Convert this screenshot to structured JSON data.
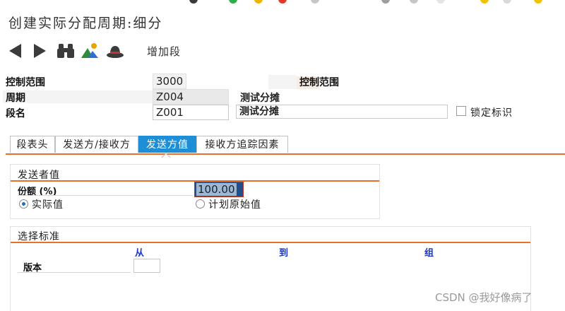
{
  "window": {
    "title": "创建实际分配周期:细分"
  },
  "toolbar": {
    "back_icon": "triangle-left-icon",
    "forward_icon": "triangle-right-icon",
    "find_icon": "binoculars-icon",
    "graphic_icon": "mountain-sun-icon",
    "hat_icon": "hat-icon",
    "add_segment_label": "增加段"
  },
  "header": {
    "control_area_label": "控制范围",
    "control_area_value": "3000",
    "control_area_text": "控制范围",
    "cycle_label": "周期",
    "cycle_value": "Z004",
    "cycle_text": "测试分摊",
    "segment_label": "段名",
    "segment_value": "Z001",
    "segment_text": "测试分摊",
    "lock_label": "锁定标识"
  },
  "tabs": [
    {
      "label": "段表头"
    },
    {
      "label": "发送方/接收方"
    },
    {
      "label": "发送方值"
    },
    {
      "label": "接收方追踪因素"
    }
  ],
  "sender_values": {
    "title": "发送者值",
    "share_label": "份额 (%)",
    "share_value": "100.00",
    "radio_actual": "实际值",
    "radio_plan": "计划原始值"
  },
  "selection": {
    "title": "选择标准",
    "col_from": "从",
    "col_to": "到",
    "col_group": "组",
    "version_label": "版本",
    "version_value": ""
  },
  "watermark": "CSDN @我好像病了",
  "colors": {
    "accent": "#1e8fd6",
    "orange": "#e8702a",
    "label_blue": "#1a36c8"
  }
}
